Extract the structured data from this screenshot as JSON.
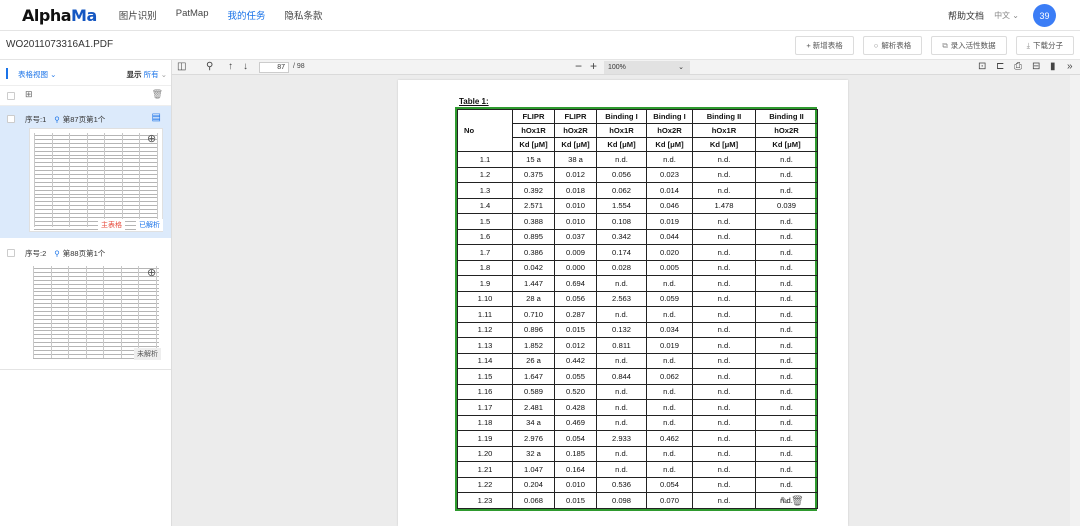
{
  "nav": {
    "logo_a": "Alpha",
    "logo_b": "Ma",
    "items": [
      "图片识别",
      "PatMap",
      "我的任务",
      "隐私条款"
    ],
    "help": "帮助文档",
    "lang": "中文",
    "avatar": "39"
  },
  "file": {
    "name": "WO2011073316A1.PDF",
    "actions": [
      "+ 新增表格",
      "解析表格",
      "录入活性数据",
      "下载分子"
    ]
  },
  "sidebar": {
    "view_label": "表格视图",
    "show_label": "显示",
    "show_value": "所有",
    "cards": [
      {
        "seq": "序号:1",
        "page": "第87页第1个",
        "tag1": "主表格",
        "tag2": "已解析"
      },
      {
        "seq": "序号:2",
        "page": "第88页第1个",
        "tag1": "",
        "tag2": "未解析"
      }
    ]
  },
  "viewer": {
    "page_num": "87",
    "page_total": "/ 98",
    "zoom": "100%"
  },
  "table": {
    "caption": "Table 1:",
    "header_top": [
      "No",
      "FLIPR",
      "FLIPR",
      "Binding I",
      "Binding I",
      "Binding II",
      "Binding II"
    ],
    "header_mid": [
      "hOx1R",
      "hOx2R",
      "hOx1R",
      "hOx2R",
      "hOx1R",
      "hOx2R"
    ],
    "header_unit": [
      "Kd [μM]",
      "Kd [μM]",
      "Kd [μM]",
      "Kd [μM]",
      "Kd [μM]",
      "Kd [μM]"
    ],
    "rows": [
      [
        "1.1",
        "15 a",
        "38 a",
        "n.d.",
        "n.d.",
        "n.d.",
        "n.d."
      ],
      [
        "1.2",
        "0.375",
        "0.012",
        "0.056",
        "0.023",
        "n.d.",
        "n.d."
      ],
      [
        "1.3",
        "0.392",
        "0.018",
        "0.062",
        "0.014",
        "n.d.",
        "n.d."
      ],
      [
        "1.4",
        "2.571",
        "0.010",
        "1.554",
        "0.046",
        "1.478",
        "0.039"
      ],
      [
        "1.5",
        "0.388",
        "0.010",
        "0.108",
        "0.019",
        "n.d.",
        "n.d."
      ],
      [
        "1.6",
        "0.895",
        "0.037",
        "0.342",
        "0.044",
        "n.d.",
        "n.d."
      ],
      [
        "1.7",
        "0.386",
        "0.009",
        "0.174",
        "0.020",
        "n.d.",
        "n.d."
      ],
      [
        "1.8",
        "0.042",
        "0.000",
        "0.028",
        "0.005",
        "n.d.",
        "n.d."
      ],
      [
        "1.9",
        "1.447",
        "0.694",
        "n.d.",
        "n.d.",
        "n.d.",
        "n.d."
      ],
      [
        "1.10",
        "28 a",
        "0.056",
        "2.563",
        "0.059",
        "n.d.",
        "n.d."
      ],
      [
        "1.11",
        "0.710",
        "0.287",
        "n.d.",
        "n.d.",
        "n.d.",
        "n.d."
      ],
      [
        "1.12",
        "0.896",
        "0.015",
        "0.132",
        "0.034",
        "n.d.",
        "n.d."
      ],
      [
        "1.13",
        "1.852",
        "0.012",
        "0.811",
        "0.019",
        "n.d.",
        "n.d."
      ],
      [
        "1.14",
        "26 a",
        "0.442",
        "n.d.",
        "n.d.",
        "n.d.",
        "n.d."
      ],
      [
        "1.15",
        "1.647",
        "0.055",
        "0.844",
        "0.062",
        "n.d.",
        "n.d."
      ],
      [
        "1.16",
        "0.589",
        "0.520",
        "n.d.",
        "n.d.",
        "n.d.",
        "n.d."
      ],
      [
        "1.17",
        "2.481",
        "0.428",
        "n.d.",
        "n.d.",
        "n.d.",
        "n.d."
      ],
      [
        "1.18",
        "34 a",
        "0.469",
        "n.d.",
        "n.d.",
        "n.d.",
        "n.d."
      ],
      [
        "1.19",
        "2.976",
        "0.054",
        "2.933",
        "0.462",
        "n.d.",
        "n.d."
      ],
      [
        "1.20",
        "32 a",
        "0.185",
        "n.d.",
        "n.d.",
        "n.d.",
        "n.d."
      ],
      [
        "1.21",
        "1.047",
        "0.164",
        "n.d.",
        "n.d.",
        "n.d.",
        "n.d."
      ],
      [
        "1.22",
        "0.204",
        "0.010",
        "0.536",
        "0.054",
        "n.d.",
        "n.d."
      ],
      [
        "1.23",
        "0.068",
        "0.015",
        "0.098",
        "0.070",
        "n.d.",
        "n.d."
      ]
    ]
  },
  "colors": {
    "accent": "#1a73e8",
    "table_border": "#2e9a2e",
    "selected_card": "#dceafb",
    "tag_main": "#e64b3c"
  }
}
